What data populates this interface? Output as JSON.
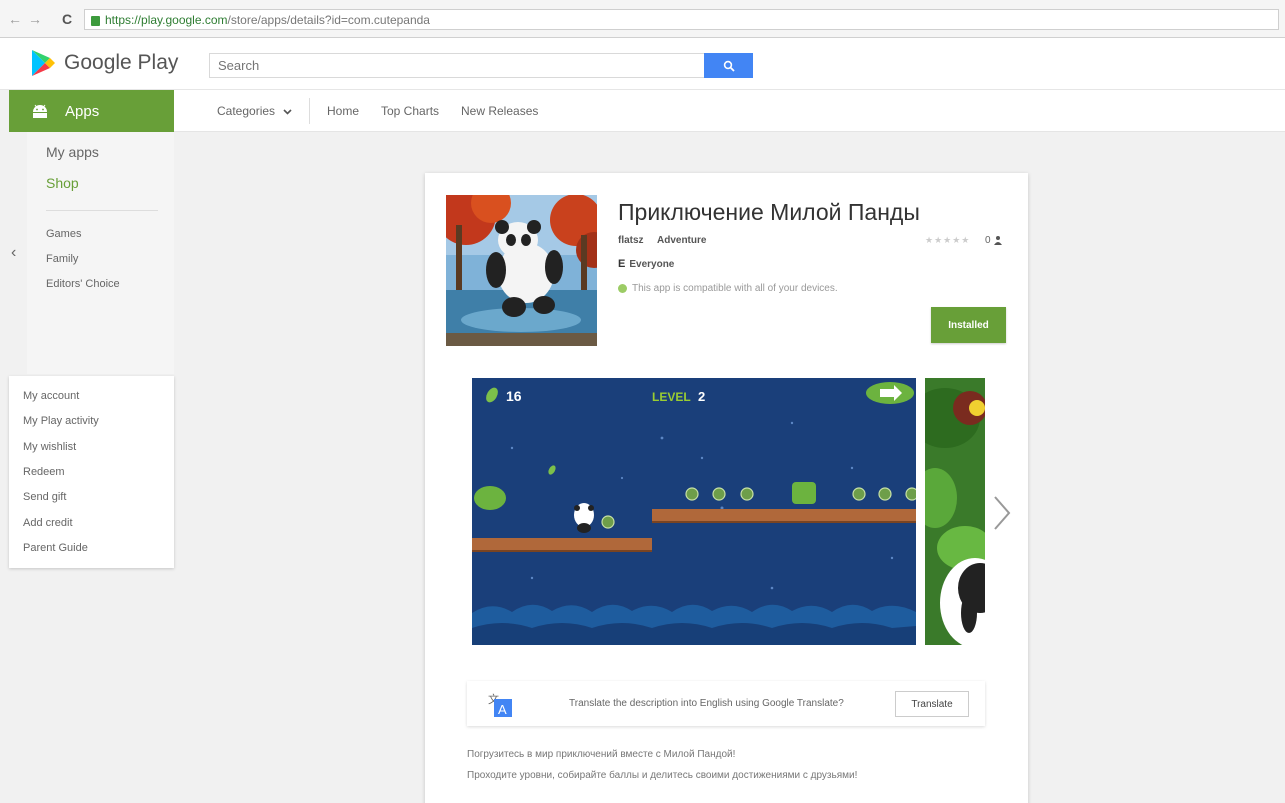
{
  "browser": {
    "back_glyph": "←",
    "forward_glyph": "→",
    "reload_glyph": "C",
    "url_host": "https://play.google.com",
    "url_path": "/store/apps/details?id=com.cutepanda"
  },
  "header": {
    "logo_text": "Google Play",
    "search_placeholder": "Search"
  },
  "subnav": {
    "categories": "Categories",
    "home": "Home",
    "top_charts": "Top Charts",
    "new_releases": "New Releases"
  },
  "sidebar": {
    "apps_label": "Apps",
    "my_apps": "My apps",
    "shop": "Shop",
    "games": "Games",
    "family": "Family",
    "editors_choice": "Editors' Choice",
    "collapse_glyph": "‹"
  },
  "account": {
    "items": [
      "My account",
      "My Play activity",
      "My wishlist",
      "Redeem",
      "Send gift",
      "Add credit",
      "Parent Guide"
    ]
  },
  "app": {
    "title": "Приключение Милой Панды",
    "developer": "flatsz",
    "category": "Adventure",
    "stars": "★★★★★",
    "rating_count": "0",
    "content_rating": "Everyone",
    "compatibility": "This app is compatible with all of your devices.",
    "install_label": "Installed",
    "hud_score": "16",
    "hud_level_label": "LEVEL",
    "hud_level_value": "2"
  },
  "translate": {
    "prompt": "Translate the description into English using Google Translate?",
    "button": "Translate"
  },
  "description": {
    "line1": "Погрузитесь в мир приключений вместе с Милой Пандой!",
    "line2": "Проходите уровни, собирайте баллы и делитесь своими достижениями с друзьями!"
  },
  "colors": {
    "play_green": "#689f38",
    "search_blue": "#4285f4"
  }
}
